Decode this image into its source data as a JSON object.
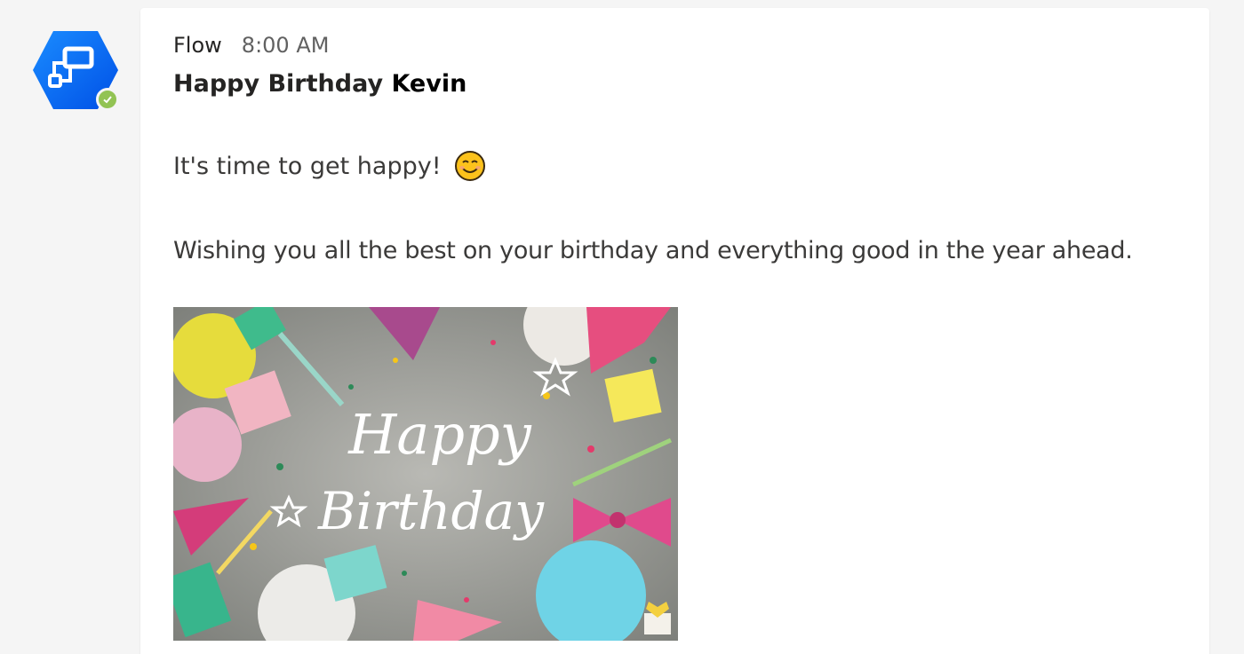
{
  "message": {
    "sender": "Flow",
    "time": "8:00 AM",
    "title_prefix": "Happy Birthday",
    "title_name": "Kevin",
    "line1": "It's time to get happy!",
    "line2": "Wishing you all the best on your birthday and everything good in the year ahead."
  },
  "image": {
    "text_line1": "Happy",
    "text_line2": "Birthday"
  },
  "icons": {
    "avatar": "power-automate-flow-icon",
    "presence": "available-check-icon",
    "emoji": "smiling-face-emoji"
  },
  "colors": {
    "avatar_blue": "#0066ff",
    "presence_green": "#92c353",
    "text_primary": "#252423",
    "text_secondary": "#616161"
  }
}
